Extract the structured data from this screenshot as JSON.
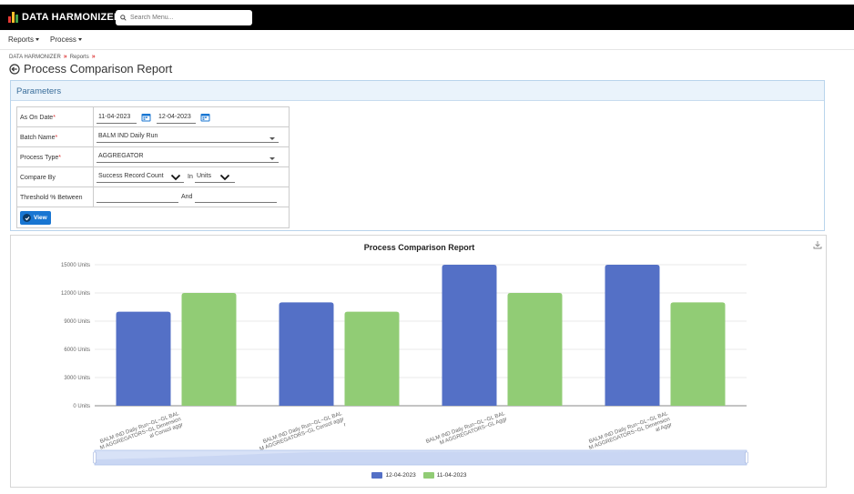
{
  "app": {
    "name": "DATA HARMONIZER",
    "search_placeholder": "Search Menu..."
  },
  "menu": [
    {
      "label": "Reports"
    },
    {
      "label": "Process"
    }
  ],
  "breadcrumb": [
    "DATA HARMONIZER",
    "Reports"
  ],
  "page_title": "Process Comparison Report",
  "parameters": {
    "header": "Parameters",
    "as_on_date_label": "As On Date",
    "date_from": "11-04-2023",
    "date_to": "12-04-2023",
    "batch_name_label": "Batch Name",
    "batch_name_value": "BALM IND Daily Run",
    "process_type_label": "Process Type",
    "process_type_value": "AGGREGATOR",
    "compare_by_label": "Compare By",
    "compare_by_value": "Success Record Count",
    "in_label": "In",
    "units_value": "Units",
    "threshold_label": "Threshold % Between",
    "and_label": "And",
    "view_button": "View"
  },
  "colors": {
    "series_a": "#5470c6",
    "series_b": "#91cc75",
    "accent": "#1976d2"
  },
  "chart_data": {
    "type": "bar",
    "title": "Process Comparison Report",
    "categories": [
      "BALM IND Daily Run~GL~GL BALM AGGREGATORS~GL Dimensional Consol aggr",
      "BALM IND Daily Run~GL~GL BALM AGGREGATORS~GL Consol aggr",
      "BALM IND Daily Run~GL~GL BALM AGGREGATORS~GL Aggr",
      "BALM IND Daily Run~GL~GL BALM AGGREGATORS~GL Dimensional Aggr"
    ],
    "category_label_lines": [
      [
        "BALM IND Daily Run~GL~GL BAL",
        "M AGGREGATORS~GL Dimension",
        "al Consol aggr"
      ],
      [
        "BALM IND Daily Run~GL~GL BAL",
        "M AGGREGATORS~GL Consol aggr",
        "r"
      ],
      [
        "BALM IND Daily Run~GL~GL BAL",
        "M AGGREGATORS~GL Aggr"
      ],
      [
        "BALM IND Daily Run~GL~GL BAL",
        "M AGGREGATORS~GL Dimension",
        "al Aggr"
      ]
    ],
    "series": [
      {
        "name": "12-04-2023",
        "values": [
          10000,
          11000,
          15000,
          15000
        ]
      },
      {
        "name": "11-04-2023",
        "values": [
          12000,
          10000,
          12000,
          11000
        ]
      }
    ],
    "yticks": [
      "0 Units",
      "3000 Units",
      "6000 Units",
      "9000 Units",
      "12000 Units",
      "15000 Units"
    ],
    "ylim": [
      0,
      15000
    ],
    "legend_position": "bottom",
    "grid": true
  }
}
